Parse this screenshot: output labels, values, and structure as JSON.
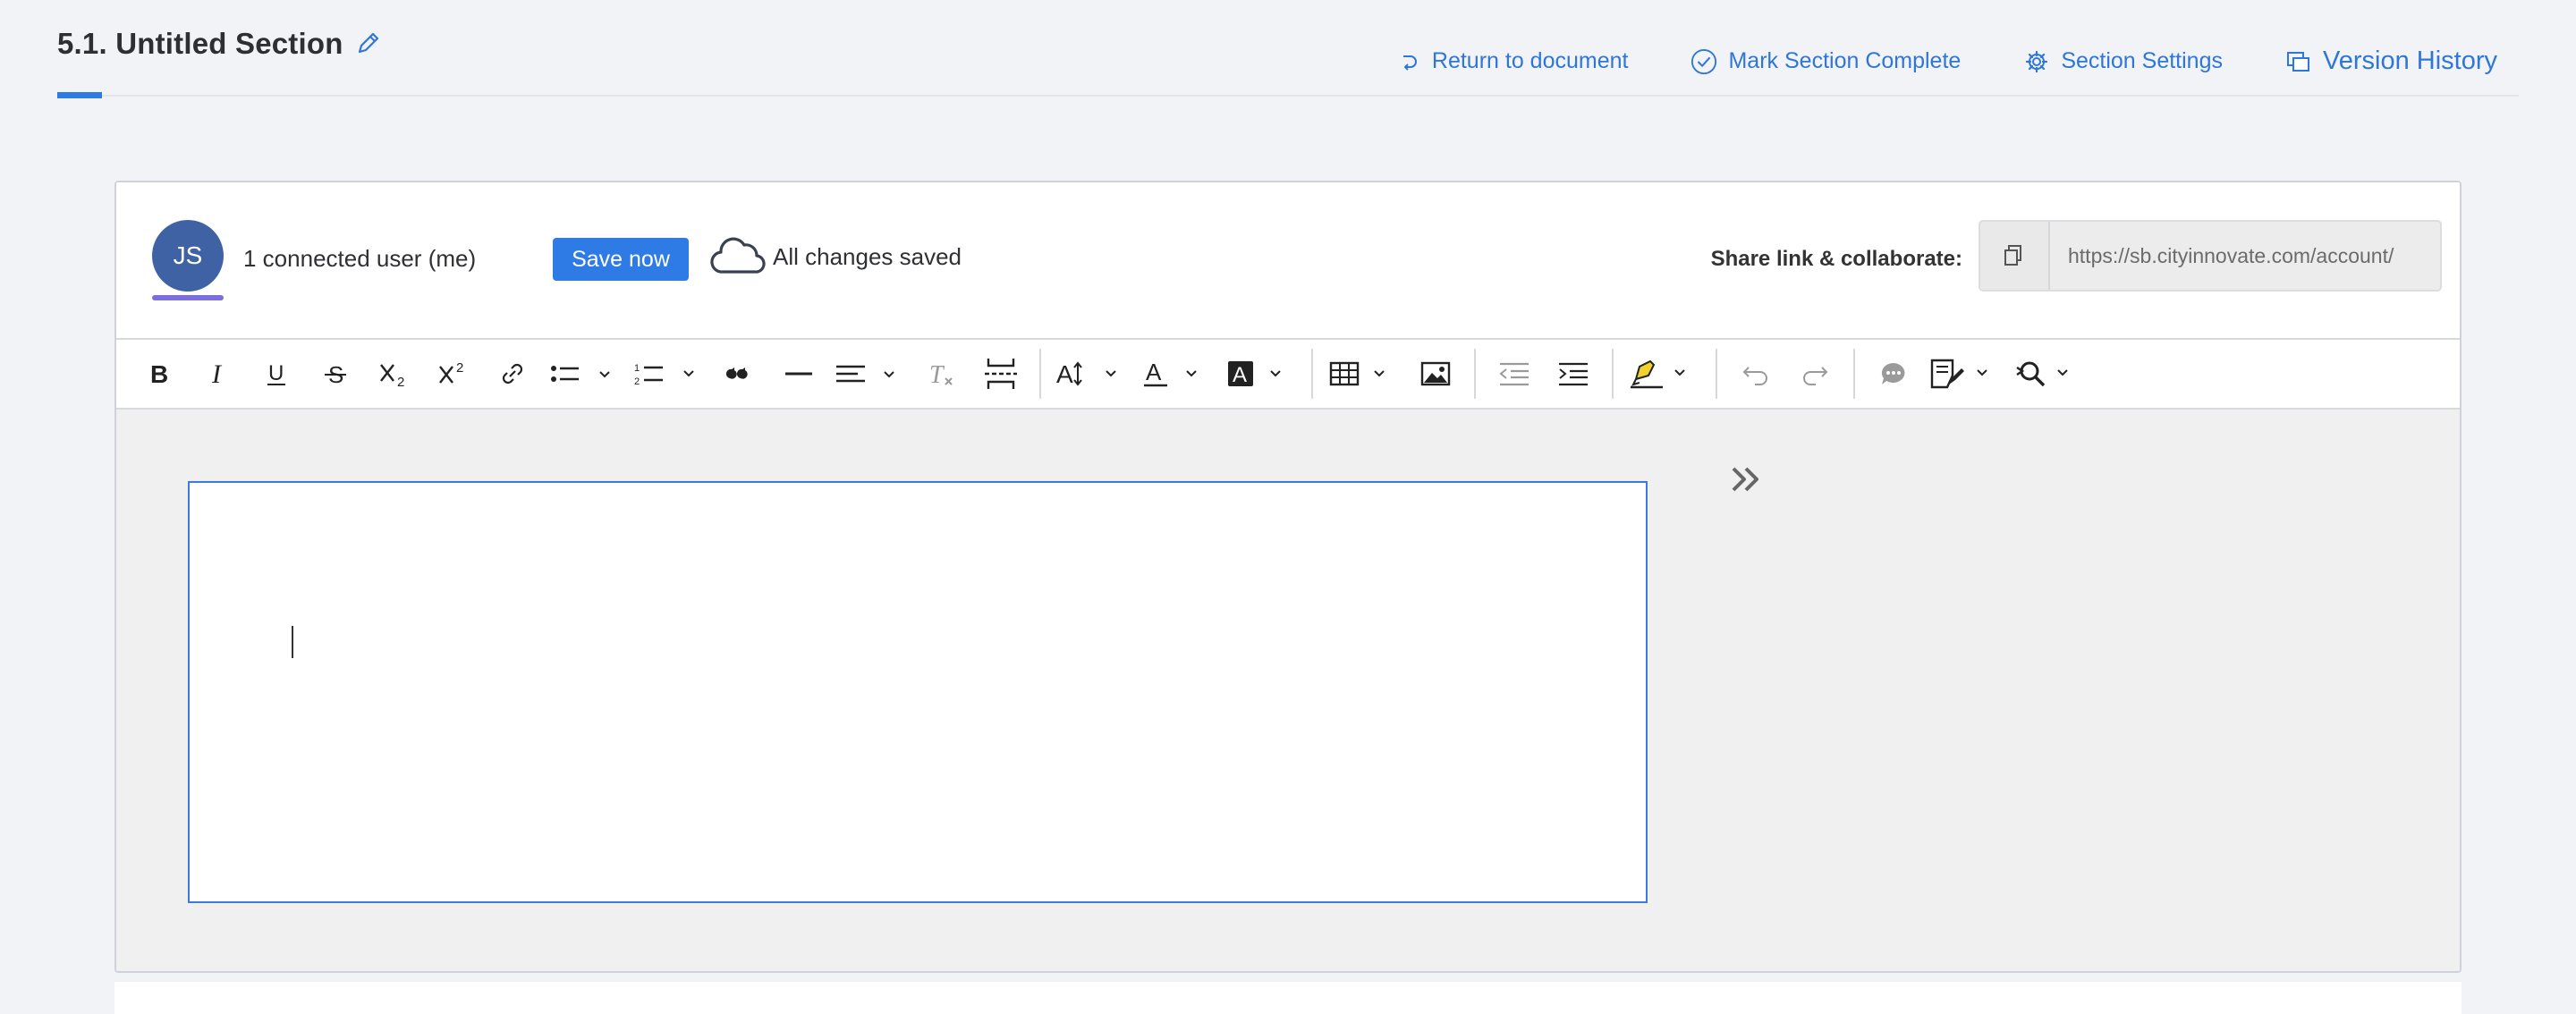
{
  "header": {
    "title": "5.1. Untitled Section",
    "actions": {
      "return": "Return to document",
      "complete": "Mark Section Complete",
      "settings": "Section Settings",
      "history": "Version History"
    }
  },
  "collab": {
    "avatar_initials": "JS",
    "users_text": "1 connected user (me)",
    "save_button": "Save now",
    "save_status": "All changes saved",
    "share_label": "Share link & collaborate:",
    "share_url": "https://sb.cityinnovate.com/account/"
  },
  "colors": {
    "accent": "#2e7be6",
    "link": "#2e76d8",
    "avatar": "#3f62a4"
  },
  "toolbar": [
    "bold-icon",
    "italic-icon",
    "underline-icon",
    "strikethrough-icon",
    "subscript-icon",
    "superscript-icon",
    "link-icon",
    "bulleted-list-icon",
    "numbered-list-icon",
    "blockquote-icon",
    "horizontal-line-icon",
    "align-icon",
    "remove-format-icon",
    "page-break-icon",
    "font-size-icon",
    "font-color-icon",
    "background-color-icon",
    "table-icon",
    "image-icon",
    "outdent-icon",
    "indent-icon",
    "highlight-icon",
    "undo-icon",
    "redo-icon",
    "comment-icon",
    "track-changes-icon",
    "find-replace-icon"
  ]
}
